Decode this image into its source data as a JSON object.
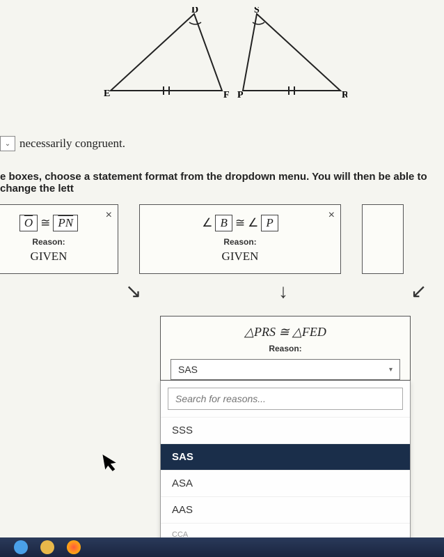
{
  "triangles": {
    "left": {
      "vertices": [
        "E",
        "D",
        "F"
      ]
    },
    "right": {
      "vertices": [
        "P",
        "S",
        "R"
      ]
    }
  },
  "sentence": {
    "dropdown_glyph": "⌄",
    "text": "necessarily congruent."
  },
  "instruction": "e boxes, choose a statement format from the dropdown menu. You will then be able to change the lett",
  "card1": {
    "lhs_prefix": "O",
    "congruent": "≅",
    "rhs": "PN",
    "reason_label": "Reason:",
    "reason_value": "GIVEN",
    "close": "×"
  },
  "card2": {
    "angle": "∠",
    "lhs": "B",
    "congruent": "≅",
    "rhs": "P",
    "reason_label": "Reason:",
    "reason_value": "GIVEN",
    "close": "×"
  },
  "arrows": {
    "a1": "↘",
    "a2": "↓",
    "a3": "↙"
  },
  "conclusion": {
    "statement": "△PRS ≅ △FED",
    "reason_label": "Reason:",
    "selected": "SAS",
    "caret": "▾",
    "search_placeholder": "Search for reasons...",
    "options": [
      "SSS",
      "SAS",
      "ASA",
      "AAS",
      "CCA"
    ]
  },
  "cursor_glyph": "➤"
}
